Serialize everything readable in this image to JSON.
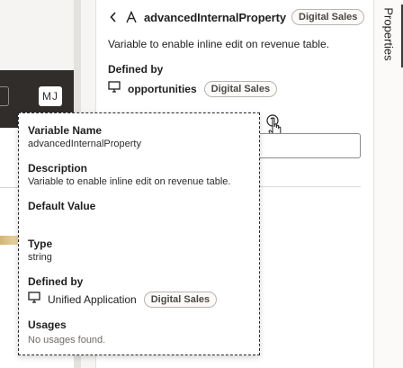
{
  "app_preview": {
    "avatar_initials": "MJ"
  },
  "panel": {
    "back_icon": "chevron-left-icon",
    "variable_icon": "variable-icon",
    "title": "advancedInternalProperty",
    "badge": "Digital Sales",
    "description": "Variable to enable inline edit on revenue table.",
    "defined_by_label": "Defined by",
    "defined_by_icon": "monitor-icon",
    "defined_by_name": "opportunities",
    "defined_by_badge": "Digital Sales",
    "help_icon": "help-icon"
  },
  "side_tab": {
    "label": "Properties"
  },
  "popup": {
    "variable_name_label": "Variable Name",
    "variable_name_value": "advancedInternalProperty",
    "description_label": "Description",
    "description_value": "Variable to enable inline edit on revenue table.",
    "default_value_label": "Default Value",
    "default_value_value": "",
    "type_label": "Type",
    "type_value": "string",
    "defined_by_label": "Defined by",
    "defined_by_icon": "monitor-icon",
    "defined_by_name": "Unified Application",
    "defined_by_badge": "Digital Sales",
    "usages_label": "Usages",
    "usages_value": "No usages found."
  },
  "colors": {
    "app_header": "#312d2a",
    "canvas": "#f1efed",
    "badge_border": "#b8b4b0",
    "text": "#1f1f1f",
    "muted": "#6f6b67"
  }
}
